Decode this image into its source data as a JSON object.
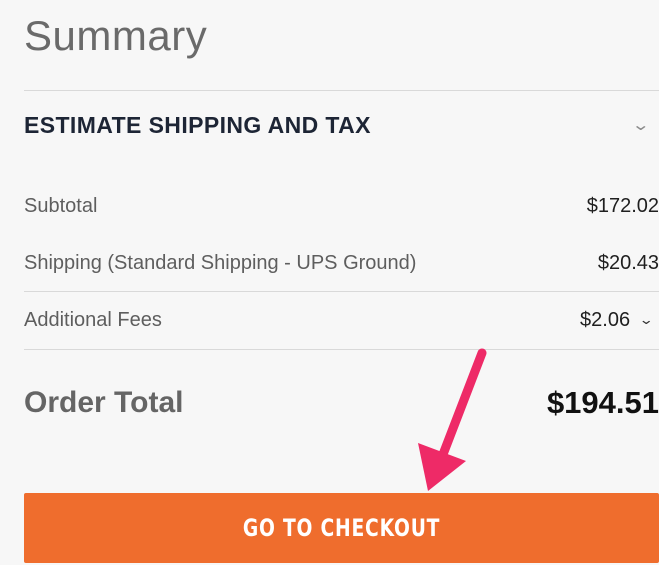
{
  "summary": {
    "title": "Summary",
    "estimate_label": "ESTIMATE SHIPPING AND TAX",
    "lines": [
      {
        "label": "Subtotal",
        "value": "$172.02"
      },
      {
        "label": "Shipping (Standard Shipping - UPS Ground)",
        "value": "$20.43"
      },
      {
        "label": "Additional Fees",
        "value": "$2.06"
      }
    ],
    "order_total_label": "Order Total",
    "order_total_value": "$194.51",
    "checkout_label": "GO TO CHECKOUT"
  },
  "icons": {
    "estimate_toggle": "chevron-down-icon",
    "fees_toggle": "chevron-down-icon",
    "annotation": "arrow-pointer-icon"
  },
  "colors": {
    "checkout_button": "#ef6d2d",
    "annotation_arrow": "#ee2a67",
    "estimate_heading": "#1d2535"
  }
}
